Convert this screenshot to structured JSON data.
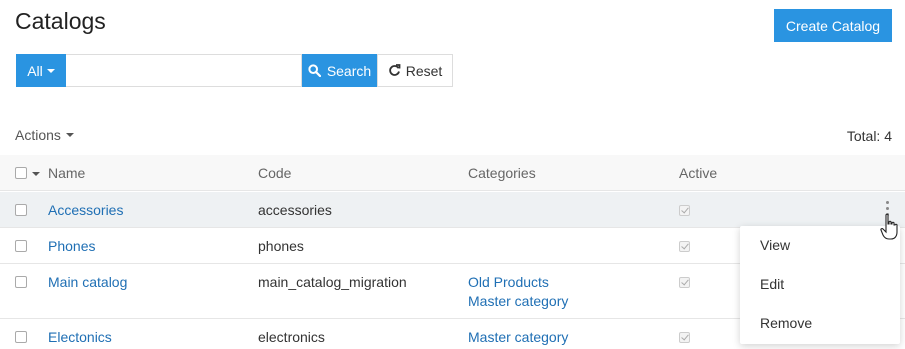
{
  "header": {
    "title": "Catalogs",
    "create_label": "Create Catalog"
  },
  "search": {
    "filter_label": "All",
    "value": "",
    "placeholder": "",
    "search_label": "Search",
    "reset_label": "Reset"
  },
  "toolbar": {
    "actions_label": "Actions",
    "total_label": "Total: 4"
  },
  "table": {
    "columns": [
      "Name",
      "Code",
      "Categories",
      "Active"
    ],
    "rows": [
      {
        "name": "Accessories",
        "code": "accessories",
        "categories": [],
        "active": true
      },
      {
        "name": "Phones",
        "code": "phones",
        "categories": [],
        "active": true
      },
      {
        "name": "Main catalog",
        "code": "main_catalog_migration",
        "categories": [
          "Old Products",
          "Master category"
        ],
        "active": true
      },
      {
        "name": "Electonics",
        "code": "electronics",
        "categories": [
          "Master category"
        ],
        "active": true
      }
    ]
  },
  "context_menu": {
    "items": [
      "View",
      "Edit",
      "Remove"
    ]
  },
  "colors": {
    "primary": "#2a94e1",
    "link": "#1f6fb4",
    "hover_row": "#eef1f3"
  }
}
